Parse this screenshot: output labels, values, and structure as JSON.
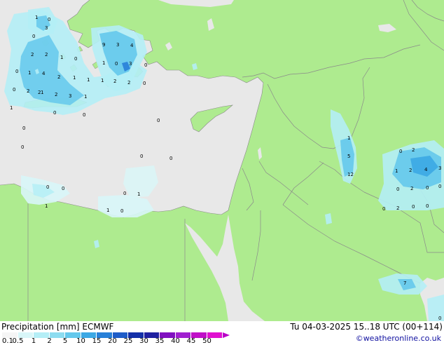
{
  "legend": {
    "title": "Precipitation [mm]  ECMWF",
    "ticks": [
      "0.1",
      "0.5",
      "1",
      "2",
      "5",
      "10",
      "15",
      "20",
      "25",
      "30",
      "35",
      "40",
      "45",
      "50"
    ],
    "colors": [
      "#f5f5f5",
      "#d8f6f8",
      "#b4eef6",
      "#8cdcf0",
      "#64c8ec",
      "#3ca8e4",
      "#2880d8",
      "#1e5cc8",
      "#1430a8",
      "#2020a0",
      "#8010c0",
      "#a020d0",
      "#c010c8",
      "#e010d0"
    ]
  },
  "header": {
    "valid_time": "Tu 04-03-2025 15..18 UTC (00+114)",
    "credit": "©weatheronline.co.uk"
  },
  "map": {
    "land_color": "#aeeb8f",
    "sea_color": "#e8e8e8",
    "labels": [
      {
        "text": "1"
      },
      {
        "text": "0"
      },
      {
        "text": "3"
      },
      {
        "text": "0"
      },
      {
        "text": "2"
      },
      {
        "text": "2"
      },
      {
        "text": "1"
      },
      {
        "text": "0"
      },
      {
        "text": "0"
      },
      {
        "text": "1"
      },
      {
        "text": "4"
      },
      {
        "text": "2"
      },
      {
        "text": "1"
      },
      {
        "text": "2"
      },
      {
        "text": "2"
      },
      {
        "text": "1"
      },
      {
        "text": "2"
      },
      {
        "text": "3"
      },
      {
        "text": "1"
      },
      {
        "text": "1"
      },
      {
        "text": "0"
      },
      {
        "text": "0"
      },
      {
        "text": "0"
      },
      {
        "text": "9"
      },
      {
        "text": "3"
      },
      {
        "text": "4"
      },
      {
        "text": "1"
      },
      {
        "text": "0"
      },
      {
        "text": "3"
      },
      {
        "text": "1"
      },
      {
        "text": "1"
      },
      {
        "text": "2"
      },
      {
        "text": "2"
      },
      {
        "text": "0"
      },
      {
        "text": "0"
      },
      {
        "text": "0"
      },
      {
        "text": "0"
      },
      {
        "text": "0"
      },
      {
        "text": "0"
      },
      {
        "text": "0"
      },
      {
        "text": "0"
      },
      {
        "text": "1"
      },
      {
        "text": "0"
      },
      {
        "text": "0"
      },
      {
        "text": "1"
      },
      {
        "text": "1"
      },
      {
        "text": "5"
      },
      {
        "text": "12"
      },
      {
        "text": "0"
      },
      {
        "text": "1"
      },
      {
        "text": "1"
      },
      {
        "text": "2"
      },
      {
        "text": "4"
      },
      {
        "text": "3"
      },
      {
        "text": "0"
      },
      {
        "text": "2"
      },
      {
        "text": "0"
      },
      {
        "text": "0"
      },
      {
        "text": "0"
      },
      {
        "text": "2"
      },
      {
        "text": "0"
      },
      {
        "text": "0"
      },
      {
        "text": "7"
      },
      {
        "text": "2"
      },
      {
        "text": "0"
      },
      {
        "text": "0"
      }
    ]
  }
}
